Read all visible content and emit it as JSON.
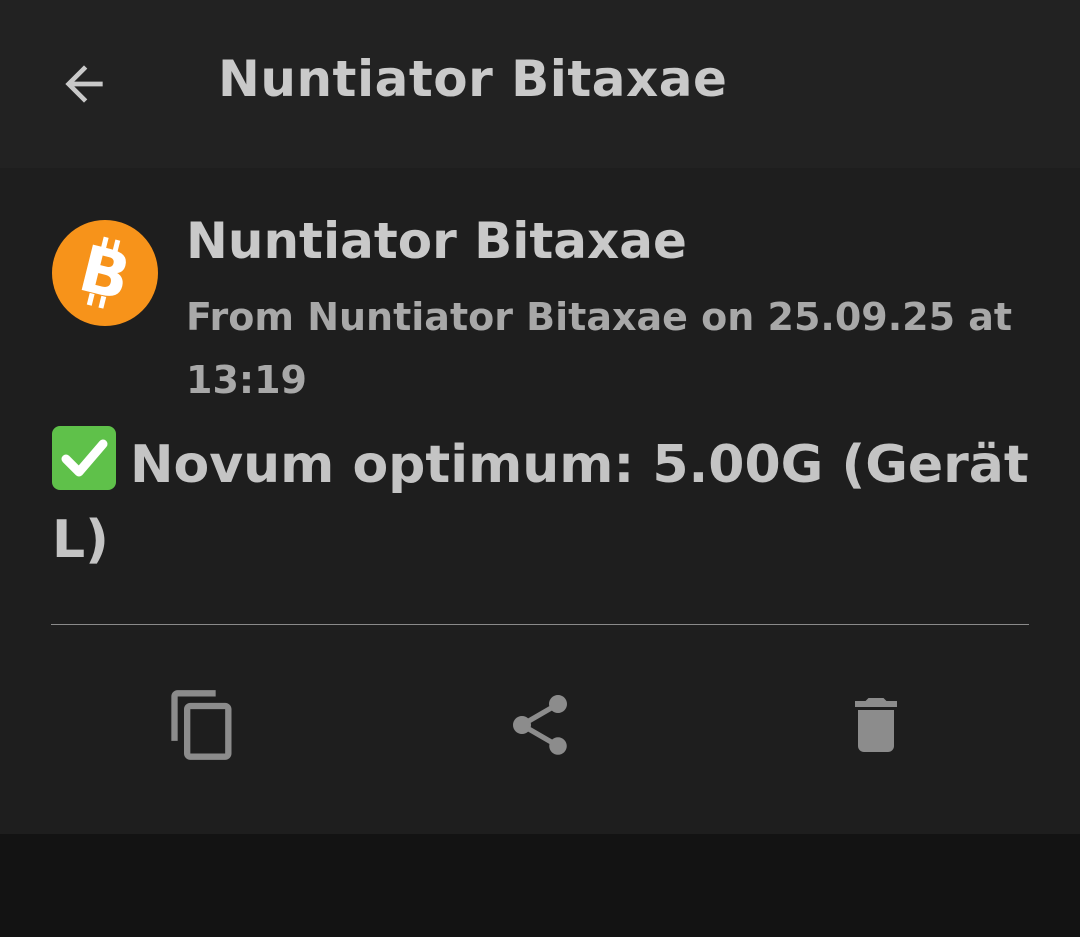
{
  "appbar": {
    "title": "Nuntiator Bitaxae",
    "back_icon": "arrow-left-icon"
  },
  "notification": {
    "avatar_icon": "bitcoin-icon",
    "avatar_color": "#f7931a",
    "sender": "Nuntiator Bitaxae",
    "meta": "From Nuntiator Bitaxae on 25.09.25 at 13:19",
    "check_icon": "check-mark-button-emoji",
    "message": "Novum optimum: 5.00G (Gerät L)"
  },
  "actions": [
    {
      "icon": "copy-icon"
    },
    {
      "icon": "share-icon"
    },
    {
      "icon": "delete-icon"
    }
  ],
  "colors": {
    "appbar_bg": "#222222",
    "card_bg": "#1e1e1e",
    "page_bg": "#131313",
    "check_green": "#5fc14a"
  }
}
